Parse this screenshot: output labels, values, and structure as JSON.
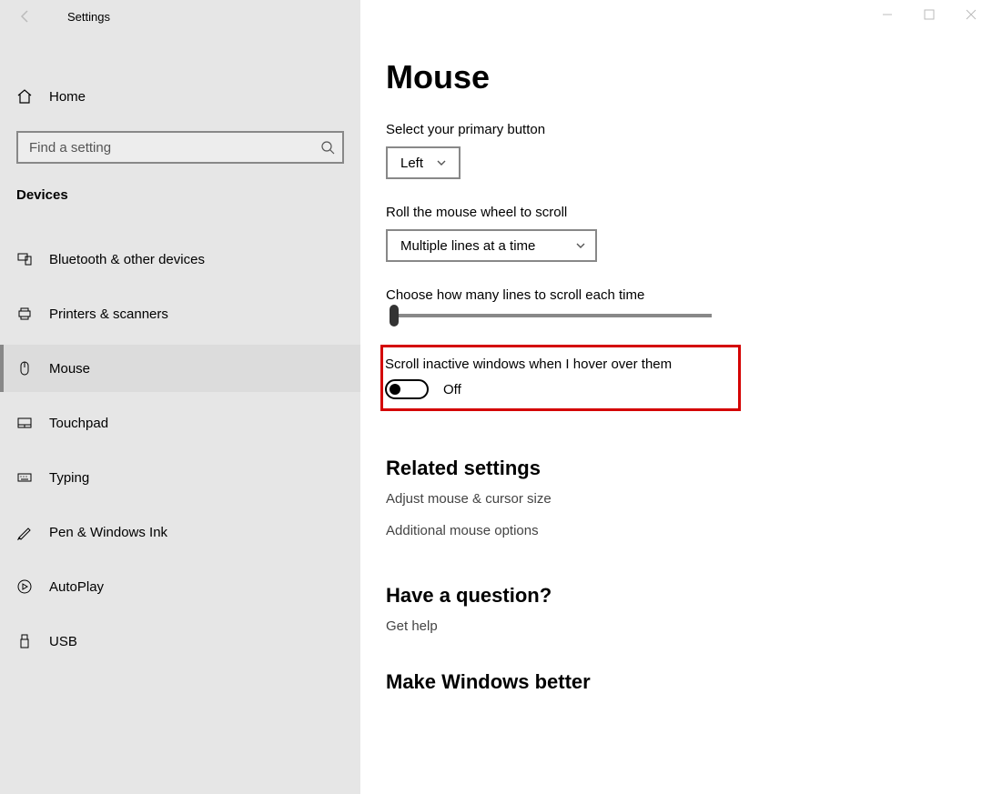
{
  "titlebar": {
    "app_name": "Settings"
  },
  "sidebar": {
    "home_label": "Home",
    "search_placeholder": "Find a setting",
    "section_label": "Devices",
    "items": [
      {
        "label": "Bluetooth & other devices"
      },
      {
        "label": "Printers & scanners"
      },
      {
        "label": "Mouse"
      },
      {
        "label": "Touchpad"
      },
      {
        "label": "Typing"
      },
      {
        "label": "Pen & Windows Ink"
      },
      {
        "label": "AutoPlay"
      },
      {
        "label": "USB"
      }
    ]
  },
  "main": {
    "title": "Mouse",
    "primary_button_label": "Select your primary button",
    "primary_button_value": "Left",
    "wheel_label": "Roll the mouse wheel to scroll",
    "wheel_value": "Multiple lines at a time",
    "lines_label": "Choose how many lines to scroll each time",
    "scroll_inactive_label": "Scroll inactive windows when I hover over them",
    "scroll_inactive_state": "Off",
    "related_title": "Related settings",
    "related_links": [
      "Adjust mouse & cursor size",
      "Additional mouse options"
    ],
    "question_title": "Have a question?",
    "question_link": "Get help",
    "improve_title": "Make Windows better"
  }
}
